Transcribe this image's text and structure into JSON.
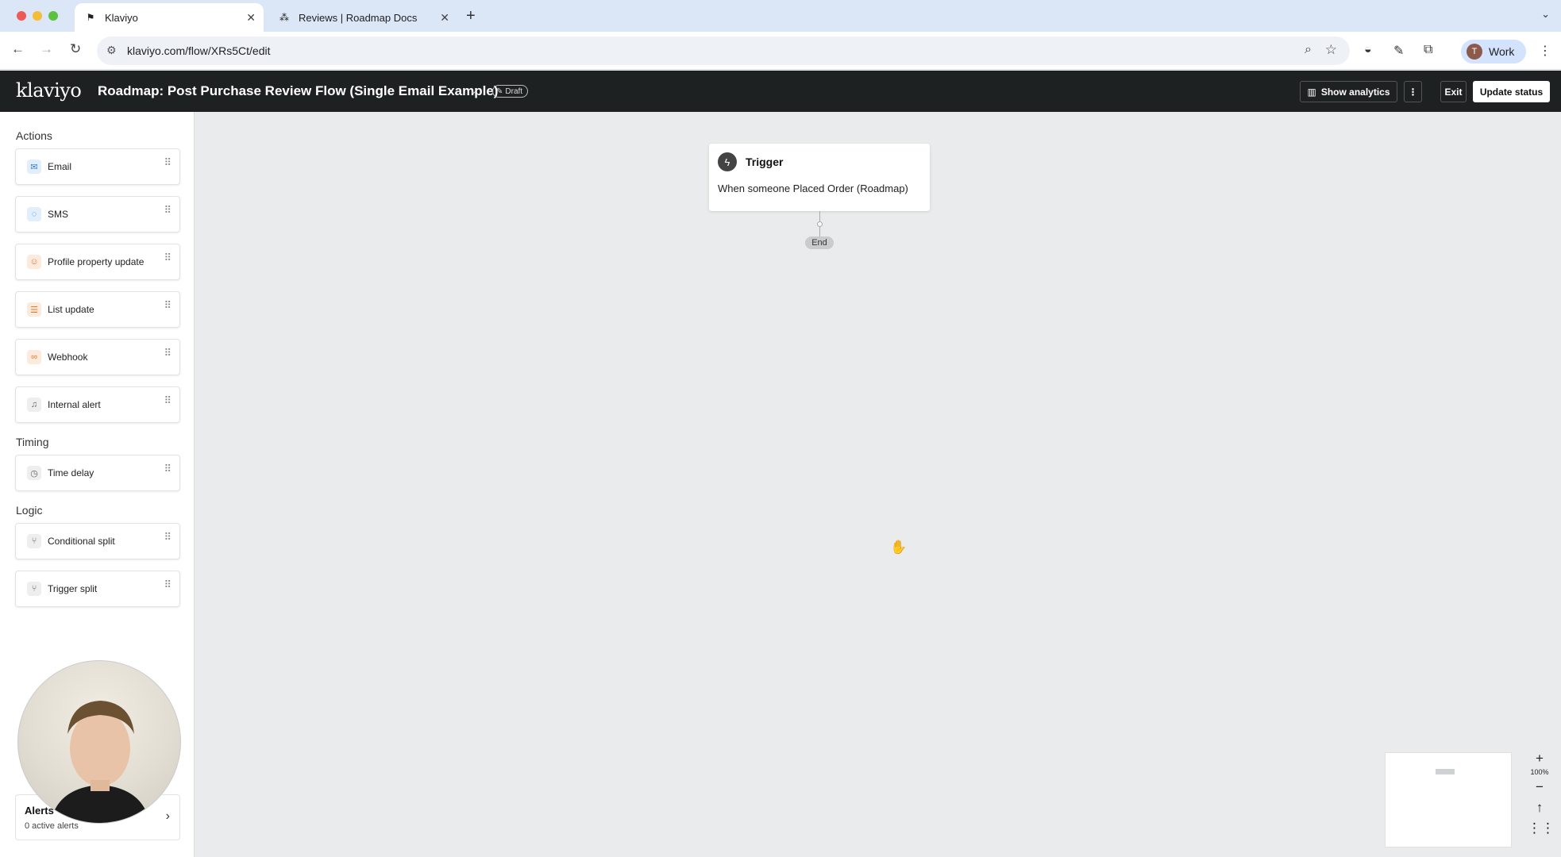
{
  "browser": {
    "tabs": [
      {
        "title": "Klaviyo",
        "active": true,
        "favicon": "klaviyo-flag-icon"
      },
      {
        "title": "Reviews | Roadmap Docs",
        "active": false,
        "favicon": "roadmap-dots-icon"
      }
    ],
    "url": "klaviyo.com/flow/XRs5Ct/edit",
    "profile_initial": "T",
    "profile_label": "Work"
  },
  "header": {
    "logo": "klaviyo",
    "flow_title": "Roadmap: Post Purchase Review Flow (Single Email Example)",
    "status_badge": "Draft",
    "show_analytics_label": "Show analytics",
    "exit_label": "Exit",
    "update_status_label": "Update status"
  },
  "sidebar": {
    "actions_title": "Actions",
    "actions": [
      {
        "label": "Email",
        "icon": "email-icon",
        "color": "#2f7de1"
      },
      {
        "label": "SMS",
        "icon": "sms-icon",
        "color": "#2f7de1"
      },
      {
        "label": "Profile property update",
        "icon": "profile-icon",
        "color": "#e0782f"
      },
      {
        "label": "List update",
        "icon": "list-icon",
        "color": "#e0782f"
      },
      {
        "label": "Webhook",
        "icon": "webhook-icon",
        "color": "#e0782f"
      },
      {
        "label": "Internal alert",
        "icon": "bell-icon",
        "color": "#666666"
      }
    ],
    "timing_title": "Timing",
    "timing": [
      {
        "label": "Time delay",
        "icon": "clock-icon",
        "color": "#666666"
      }
    ],
    "logic_title": "Logic",
    "logic": [
      {
        "label": "Conditional split",
        "icon": "split-icon",
        "color": "#666666"
      },
      {
        "label": "Trigger split",
        "icon": "trigger-split-icon",
        "color": "#666666"
      }
    ],
    "alerts": {
      "title": "Alerts",
      "subtitle": "0 active alerts"
    }
  },
  "canvas": {
    "trigger": {
      "title": "Trigger",
      "description": "When someone Placed Order (Roadmap)"
    },
    "end_label": "End",
    "zoom_level": "100%"
  }
}
